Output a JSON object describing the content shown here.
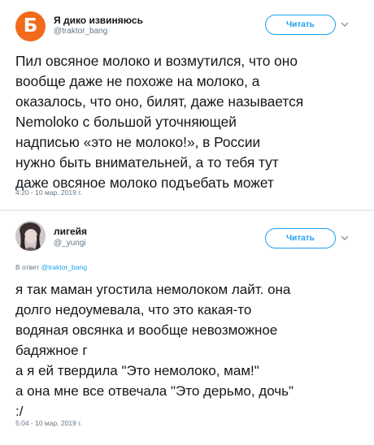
{
  "colors": {
    "accent": "#1da1f2",
    "avatar_orange": "#f26a1b",
    "muted": "#657786"
  },
  "tweets": [
    {
      "avatar": {
        "letter": "Б",
        "icon": "orange-b-logo-avatar"
      },
      "display_name": "Я дико извиняюсь",
      "handle": "@traktor_bang",
      "follow_label": "Читать",
      "text": "Пил овсяное молоко и возмутился, что оно\nвообще даже не похоже на молоко, а\nоказалось, что оно, билят, даже называется\nNemoloko с большой уточняющей\nнадписью «это не молоко!», в России\nнужно быть внимательней, а то тебя тут\nдаже овсяное молоко подъебать может",
      "timestamp": "4:20 - 10 мар. 2019 г."
    },
    {
      "avatar": {
        "icon": "user-photo-avatar"
      },
      "display_name": "лигейя",
      "handle": "@_yungi",
      "follow_label": "Читать",
      "reply_prefix": "В ответ",
      "reply_mention": "@traktor_bang",
      "text": "я так маман угостила немолоком лайт. она\nдолго недоумевала, что это какая-то\nводяная овсянка и вообще невозможное\nбадяжное г\nа я ей твердила \"Это немолоко, мам!\"\nа она мне все отвечала \"Это дерьмо, дочь\"\n:/",
      "timestamp": "5:04 - 10 мар. 2019 г."
    }
  ]
}
